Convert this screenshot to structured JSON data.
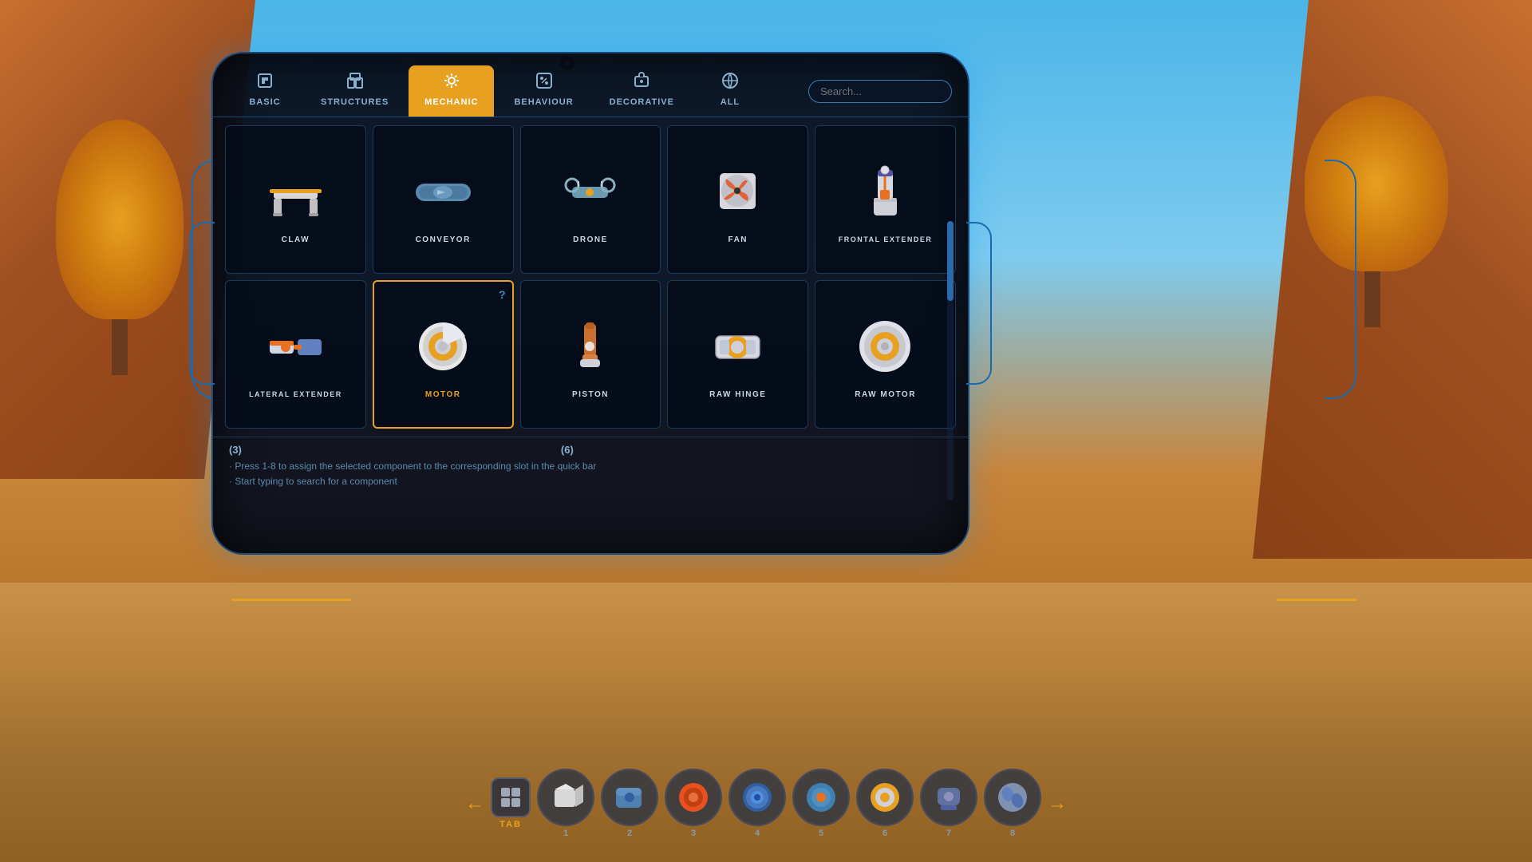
{
  "background": {
    "sky_color": "#4ab5e8",
    "ground_color": "#c8924a"
  },
  "top_connector": {
    "close_label": "✕"
  },
  "tabs": [
    {
      "id": "basic",
      "label": "BASIC",
      "icon": "⬡",
      "active": false
    },
    {
      "id": "structures",
      "label": "STRUCTURES",
      "icon": "⬜",
      "active": false
    },
    {
      "id": "mechanic",
      "label": "MECHANIC",
      "icon": "⚙",
      "active": true
    },
    {
      "id": "behaviour",
      "label": "BEHAVIOUR",
      "icon": "⬡",
      "active": false
    },
    {
      "id": "decorative",
      "label": "DECORATIVE",
      "icon": "🎁",
      "active": false
    },
    {
      "id": "all",
      "label": "ALL",
      "icon": "⊞",
      "active": false
    }
  ],
  "search": {
    "placeholder": "Search..."
  },
  "grid_items": [
    {
      "id": "claw",
      "label": "CLAW",
      "selected": false,
      "has_question": false,
      "color": "#e8a020"
    },
    {
      "id": "conveyor",
      "label": "CONVEYOR",
      "selected": false,
      "has_question": false,
      "color": "#7ab0d0"
    },
    {
      "id": "drone",
      "label": "DRONE",
      "selected": false,
      "has_question": false,
      "color": "#7ab0d0"
    },
    {
      "id": "fan",
      "label": "FAN",
      "selected": false,
      "has_question": false,
      "color": "#c8d0d8"
    },
    {
      "id": "frontal-extender",
      "label": "FRONTAL EXTENDER",
      "selected": false,
      "has_question": false,
      "color": "#e87020"
    },
    {
      "id": "lateral-extender",
      "label": "LATERAL EXTENDER",
      "selected": false,
      "has_question": false,
      "color": "#e87020"
    },
    {
      "id": "motor",
      "label": "MOTOR",
      "selected": true,
      "has_question": true,
      "color": "#e8a020"
    },
    {
      "id": "piston",
      "label": "PISTON",
      "selected": false,
      "has_question": false,
      "color": "#c87030"
    },
    {
      "id": "raw-hinge",
      "label": "RAW HINGE",
      "selected": false,
      "has_question": false,
      "color": "#e8a020"
    },
    {
      "id": "raw-motor",
      "label": "RAW MOTOR",
      "selected": false,
      "has_question": false,
      "color": "#e8a020"
    }
  ],
  "info_bar": {
    "num_left": "(3)",
    "num_right": "(6)",
    "hint1": "· Press 1-8 to assign the selected component to the corresponding slot in the quick bar",
    "hint2": "· Start typing to search for a component"
  },
  "quickbar": {
    "tab_label": "TAB",
    "slots": [
      {
        "num": "1"
      },
      {
        "num": "2"
      },
      {
        "num": "3"
      },
      {
        "num": "4"
      },
      {
        "num": "5"
      },
      {
        "num": "6"
      },
      {
        "num": "7"
      },
      {
        "num": "8"
      }
    ]
  }
}
